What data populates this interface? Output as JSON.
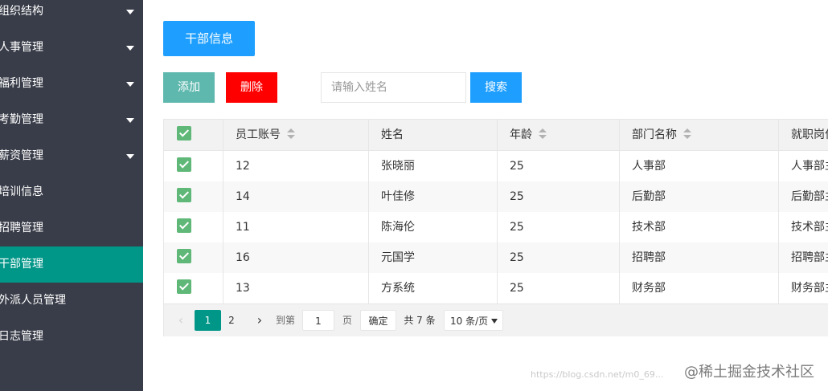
{
  "sidebar": {
    "items": [
      {
        "label": "组织结构",
        "expandable": true,
        "active": false
      },
      {
        "label": "人事管理",
        "expandable": true,
        "active": false
      },
      {
        "label": "福利管理",
        "expandable": true,
        "active": false
      },
      {
        "label": "考勤管理",
        "expandable": true,
        "active": false
      },
      {
        "label": "薪资管理",
        "expandable": true,
        "active": false
      },
      {
        "label": "培训信息",
        "expandable": false,
        "active": false
      },
      {
        "label": "招聘管理",
        "expandable": false,
        "active": false
      },
      {
        "label": "干部管理",
        "expandable": false,
        "active": true
      },
      {
        "label": "外派人员管理",
        "expandable": false,
        "active": false
      },
      {
        "label": "日志管理",
        "expandable": false,
        "active": false
      }
    ]
  },
  "main": {
    "title": "干部信息",
    "toolbar": {
      "add_label": "添加",
      "delete_label": "删除",
      "search_placeholder": "请输入姓名",
      "search_value": "",
      "search_label": "搜索"
    },
    "table": {
      "columns": [
        "员工账号",
        "姓名",
        "年龄",
        "部门名称",
        "就职岗位"
      ],
      "rows": [
        {
          "checked": true,
          "cells": [
            "12",
            "张晓丽",
            "25",
            "人事部",
            "人事部主管"
          ]
        },
        {
          "checked": true,
          "cells": [
            "14",
            "叶佳修",
            "25",
            "后勤部",
            "后勤部主管"
          ]
        },
        {
          "checked": true,
          "cells": [
            "11",
            "陈海伦",
            "25",
            "技术部",
            "技术部主管"
          ]
        },
        {
          "checked": true,
          "cells": [
            "16",
            "元国学",
            "25",
            "招聘部",
            "招聘部主管"
          ]
        },
        {
          "checked": true,
          "cells": [
            "13",
            "方系统",
            "25",
            "财务部",
            "财务部主管"
          ]
        }
      ]
    },
    "pager": {
      "prev": "‹",
      "pages": [
        "1",
        "2"
      ],
      "current": "1",
      "next": "›",
      "goto_label": "到第",
      "goto_value": "1",
      "page_label": "页",
      "confirm_label": "确定",
      "total": "共 7 条",
      "page_size": "10 条/页"
    }
  },
  "watermark": {
    "site": "https://blog.csdn.net/m0_69...",
    "text": "@稀土掘金技术社区"
  },
  "colors": {
    "sidebar_bg": "#393d49",
    "active": "#009688",
    "primary": "#1e9fff",
    "add": "#5fb8ae",
    "delete": "#ff0000",
    "checkbox": "#5fb878"
  }
}
